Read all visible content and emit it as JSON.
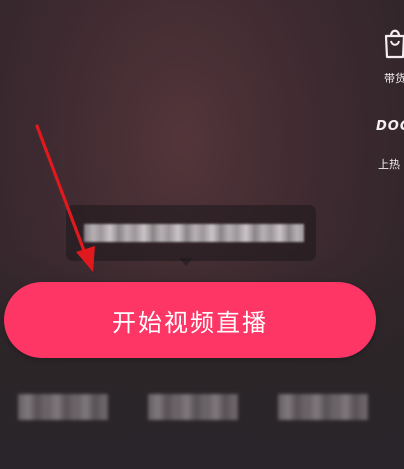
{
  "right_rail": {
    "daihuo_label": "带货",
    "doc_logo_text": "DOC",
    "shangre_label": "上热"
  },
  "tooltip": {
    "text": ""
  },
  "main": {
    "start_live_label": "开始视频直播"
  },
  "colors": {
    "primary_button": "#fe3666",
    "annotation_arrow": "#e0191f"
  },
  "icons": {
    "daihuo": "shopping-bag-icon"
  }
}
